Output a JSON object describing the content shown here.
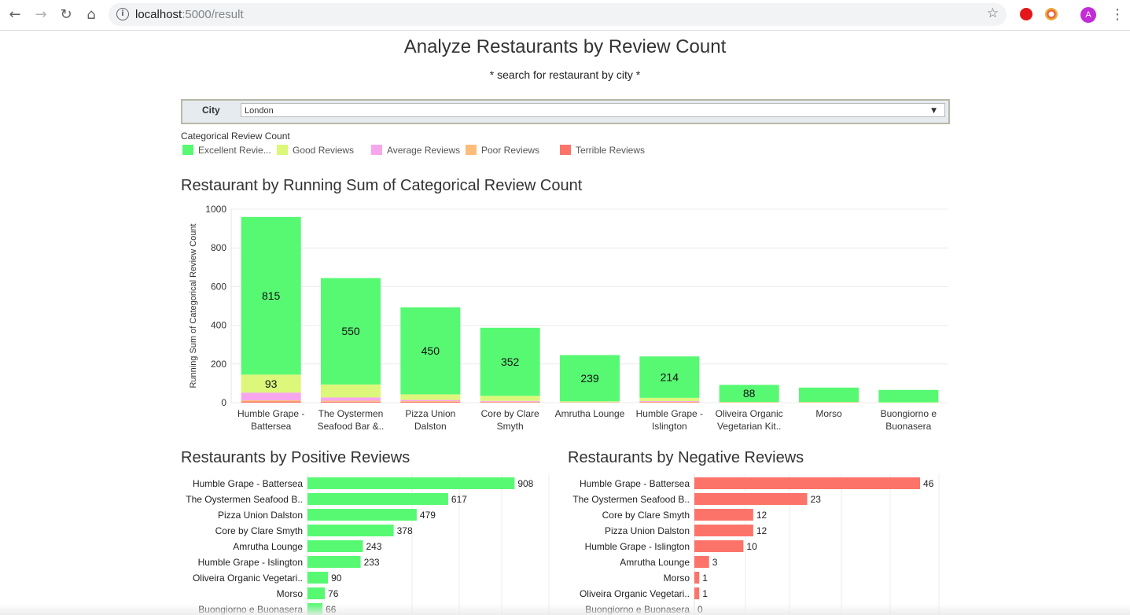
{
  "browser": {
    "url_host": "localhost",
    "url_rest": ":5000/result",
    "profile_initial": "A"
  },
  "page": {
    "title": "Analyze Restaurants by Review Count",
    "subtitle": "* search for restaurant by city *"
  },
  "filter": {
    "label": "City",
    "value": "London"
  },
  "legend": {
    "title": "Categorical Review Count",
    "items": [
      {
        "label": "Excellent Revie...",
        "color": "#57f973"
      },
      {
        "label": "Good Reviews",
        "color": "#dcf77a"
      },
      {
        "label": "Average Reviews",
        "color": "#f7a6ee"
      },
      {
        "label": "Poor Reviews",
        "color": "#fbbd79"
      },
      {
        "label": "Terrible Reviews",
        "color": "#fc736a"
      }
    ]
  },
  "chart_data": [
    {
      "type": "bar",
      "stacked": true,
      "title": "Restaurant by Running Sum of Categorical Review Count",
      "ylabel": "Running Sum of Categorical Review Count",
      "ylim": [
        0,
        1000
      ],
      "yticks": [
        0,
        200,
        400,
        600,
        800,
        1000
      ],
      "grid": true,
      "categories": [
        [
          "Humble Grape -",
          "Battersea"
        ],
        [
          "The Oystermen",
          "Seafood Bar &.."
        ],
        [
          "Pizza Union",
          "Dalston"
        ],
        [
          "Core by Clare",
          "Smyth"
        ],
        [
          "Amrutha Lounge"
        ],
        [
          "Humble Grape -",
          "Islington"
        ],
        [
          "Oliveira Organic",
          "Vegetarian Kit.."
        ],
        [
          "Morso"
        ],
        [
          "Buongiorno e",
          "Buonasera"
        ]
      ],
      "series": [
        {
          "name": "Terrible Reviews",
          "color": "#fc736a",
          "values": [
            6,
            5,
            4,
            3,
            1,
            2,
            1,
            1,
            0
          ]
        },
        {
          "name": "Poor Reviews",
          "color": "#fbbd79",
          "values": [
            6,
            5,
            4,
            2,
            1,
            2,
            1,
            1,
            0
          ]
        },
        {
          "name": "Average Reviews",
          "color": "#f7a6ee",
          "values": [
            40,
            17,
            6,
            4,
            1,
            4,
            0,
            0,
            0
          ]
        },
        {
          "name": "Good Reviews",
          "color": "#dcf77a",
          "values": [
            93,
            67,
            29,
            26,
            4,
            17,
            2,
            2,
            2
          ]
        },
        {
          "name": "Excellent Reviews",
          "color": "#57f973",
          "values": [
            815,
            550,
            450,
            352,
            239,
            214,
            88,
            74,
            64
          ]
        }
      ],
      "data_labels": [
        {
          "category": 0,
          "series": "Good Reviews",
          "value": 93
        },
        {
          "category": 0,
          "series": "Excellent Reviews",
          "value": 815
        },
        {
          "category": 1,
          "series": "Excellent Reviews",
          "value": 550
        },
        {
          "category": 2,
          "series": "Excellent Reviews",
          "value": 450
        },
        {
          "category": 3,
          "series": "Excellent Reviews",
          "value": 352
        },
        {
          "category": 4,
          "series": "Excellent Reviews",
          "value": 239
        },
        {
          "category": 5,
          "series": "Excellent Reviews",
          "value": 214
        },
        {
          "category": 6,
          "series": "Excellent Reviews",
          "value": 88
        }
      ]
    },
    {
      "type": "bar",
      "orientation": "horizontal",
      "title": "Restaurants by Positive Reviews",
      "color": "#57f973",
      "xlim": [
        0,
        1000
      ],
      "categories": [
        "Humble Grape - Battersea",
        "The Oystermen Seafood B..",
        "Pizza Union Dalston",
        "Core by Clare Smyth",
        "Amrutha Lounge",
        "Humble Grape - Islington",
        "Oliveira Organic Vegetari..",
        "Morso",
        "Buongiorno e Buonasera"
      ],
      "values": [
        908,
        617,
        479,
        378,
        243,
        233,
        90,
        76,
        66
      ]
    },
    {
      "type": "bar",
      "orientation": "horizontal",
      "title": "Restaurants by Negative Reviews",
      "color": "#fc736a",
      "xlim": [
        0,
        50
      ],
      "categories": [
        "Humble Grape - Battersea",
        "The Oystermen Seafood B..",
        "Core by Clare Smyth",
        "Pizza Union Dalston",
        "Humble Grape - Islington",
        "Amrutha Lounge",
        "Morso",
        "Oliveira Organic Vegetari..",
        "Buongiorno e Buonasera"
      ],
      "values": [
        46,
        23,
        12,
        12,
        10,
        3,
        1,
        1,
        0
      ]
    }
  ]
}
